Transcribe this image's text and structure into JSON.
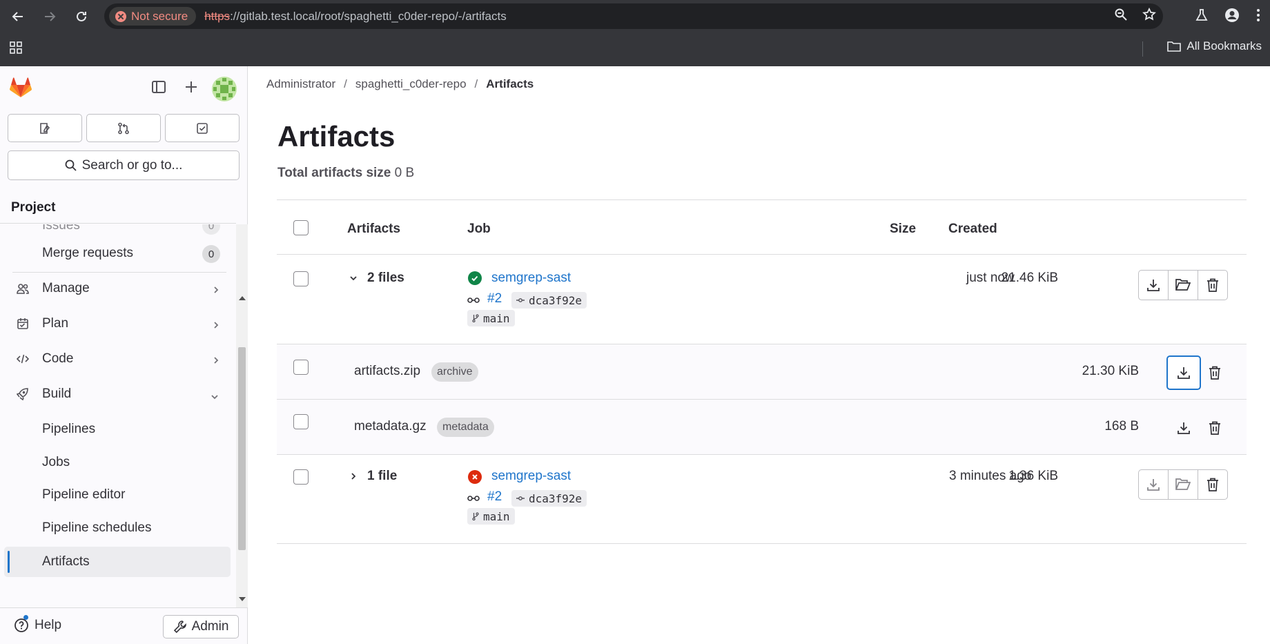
{
  "browser": {
    "not_secure": "Not secure",
    "url_proto": "https",
    "url_rest": "://gitlab.test.local/root/spaghetti_c0der-repo/-/artifacts",
    "all_bookmarks": "All Bookmarks"
  },
  "sidebar": {
    "search_placeholder": "Search or go to...",
    "section_title": "Project",
    "items": [
      {
        "label": "Issues",
        "count": "0"
      },
      {
        "label": "Merge requests",
        "count": "0"
      },
      {
        "label": "Manage"
      },
      {
        "label": "Plan"
      },
      {
        "label": "Code"
      },
      {
        "label": "Build"
      },
      {
        "label": "Pipelines"
      },
      {
        "label": "Jobs"
      },
      {
        "label": "Pipeline editor"
      },
      {
        "label": "Pipeline schedules"
      },
      {
        "label": "Artifacts"
      }
    ],
    "help": "Help",
    "admin": "Admin"
  },
  "breadcrumb": [
    "Administrator",
    "spaghetti_c0der-repo",
    "Artifacts"
  ],
  "page": {
    "title": "Artifacts",
    "total_label": "Total artifacts size",
    "total_value": "0 B"
  },
  "table": {
    "headers": {
      "artifacts": "Artifacts",
      "job": "Job",
      "size": "Size",
      "created": "Created"
    },
    "groups": [
      {
        "files": "2 files",
        "job": "semgrep-sast",
        "status": "success",
        "pipeline": "#2",
        "commit": "dca3f92e",
        "branch": "main",
        "size": "21.46 KiB",
        "created": "just now",
        "expanded": true,
        "children": [
          {
            "name": "artifacts.zip",
            "tag": "archive",
            "size": "21.30 KiB"
          },
          {
            "name": "metadata.gz",
            "tag": "metadata",
            "size": "168 B"
          }
        ]
      },
      {
        "files": "1 file",
        "job": "semgrep-sast",
        "status": "failed",
        "pipeline": "#2",
        "commit": "dca3f92e",
        "branch": "main",
        "size": "1.36 KiB",
        "created": "3 minutes ago",
        "expanded": false
      }
    ]
  },
  "colors": {
    "link": "#1f75cb",
    "success": "#108548",
    "failed": "#dd2b0e",
    "brand": "#e24329"
  }
}
